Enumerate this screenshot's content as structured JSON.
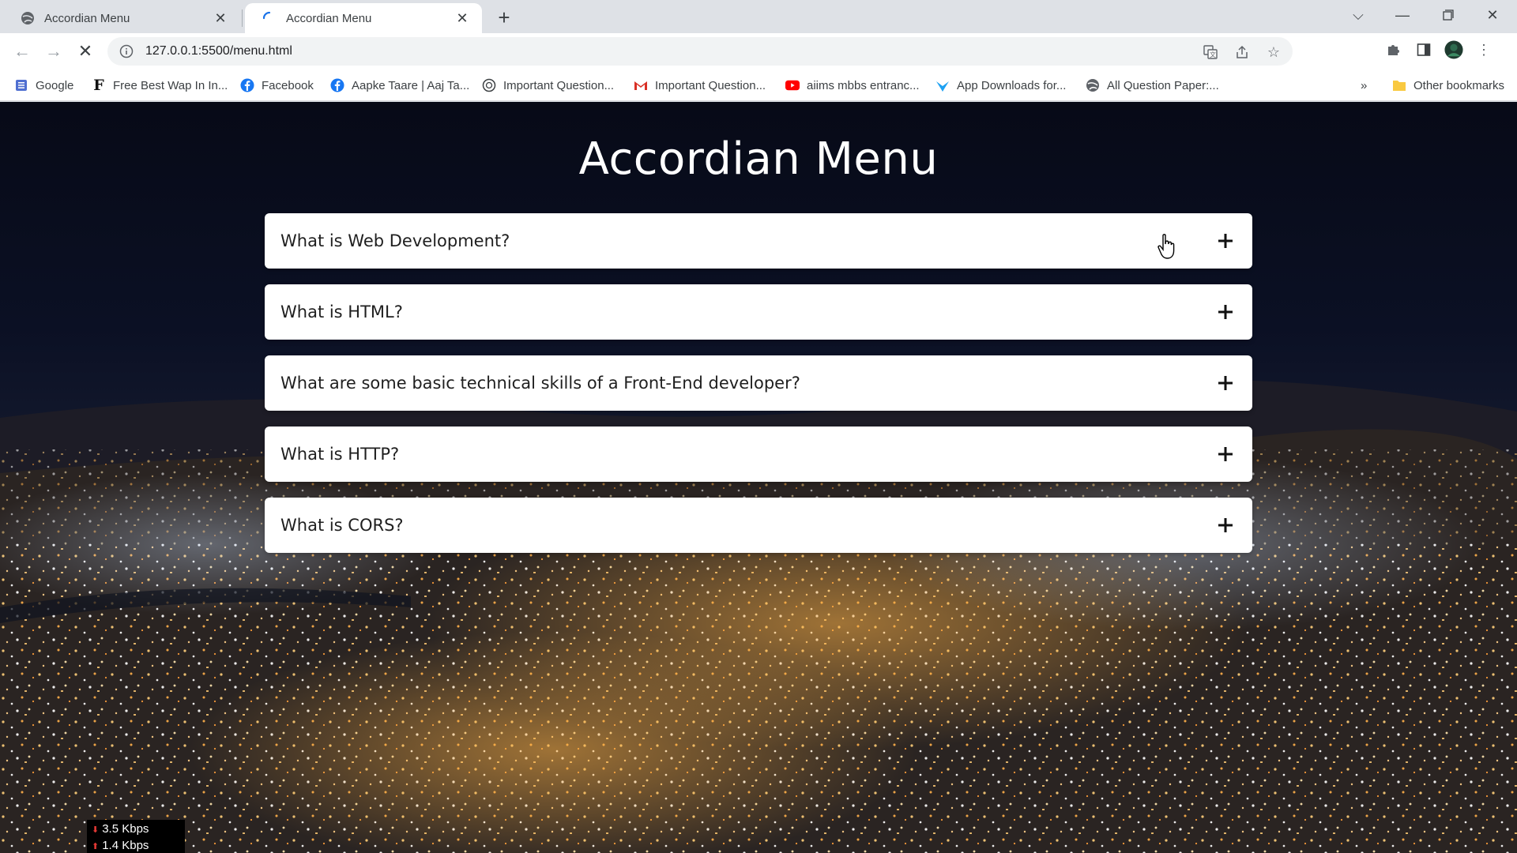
{
  "browser": {
    "tabs": [
      {
        "title": "Accordian Menu",
        "active": false
      },
      {
        "title": "Accordian Menu",
        "active": true
      }
    ],
    "url": "127.0.0.1:5500/menu.html",
    "bookmarks": [
      {
        "label": "Google",
        "icon": "google-apps-icon"
      },
      {
        "label": "Free Best Wap In In...",
        "icon": "f-letter-icon"
      },
      {
        "label": "Facebook",
        "icon": "facebook-icon"
      },
      {
        "label": "Aapke Taare | Aaj Ta...",
        "icon": "facebook-icon"
      },
      {
        "label": "Important Question...",
        "icon": "globe-icon"
      },
      {
        "label": "Important Question...",
        "icon": "gmail-icon"
      },
      {
        "label": "aiims mbbs entranc...",
        "icon": "youtube-icon"
      },
      {
        "label": "App Downloads for...",
        "icon": "bird-icon"
      },
      {
        "label": "All Question Paper:...",
        "icon": "globe-icon"
      }
    ],
    "overflow_label": "»",
    "other_bookmarks": "Other bookmarks"
  },
  "page": {
    "title": "Accordian Menu",
    "accordion": [
      {
        "question": "What is Web Development?"
      },
      {
        "question": "What is HTML?"
      },
      {
        "question": "What are some basic technical skills of a Front-End developer?"
      },
      {
        "question": "What is HTTP?"
      },
      {
        "question": "What is CORS?"
      }
    ]
  },
  "netspeed": {
    "down": "3.5 Kbps",
    "up": "1.4 Kbps"
  },
  "colors": {
    "tabstrip": "#dee1e6",
    "accordion_bg": "#ffffff",
    "title_color": "#ffffff"
  }
}
